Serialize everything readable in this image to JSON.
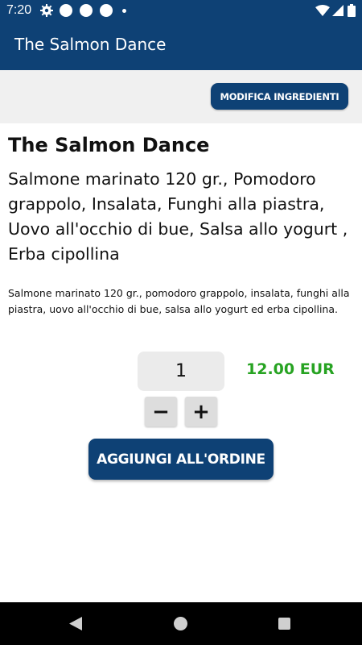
{
  "status_bar": {
    "time": "7:20",
    "icons": [
      "gear-icon",
      "notification-dot-icon",
      "notification-dot-icon",
      "notification-dot-icon",
      "small-dot-icon",
      "wifi-icon",
      "signal-icon",
      "battery-icon"
    ]
  },
  "app_bar": {
    "title": "The Salmon Dance"
  },
  "toolbar": {
    "edit_ingredients_label": "MODIFICA INGREDIENTI"
  },
  "dish": {
    "name": "The Salmon Dance",
    "ingredients": "Salmone marinato 120 gr., Pomodoro grappolo, Insalata, Funghi alla piastra, Uovo all'occhio di bue, Salsa allo yogurt , Erba cipollina",
    "description": "Salmone marinato 120 gr., pomodoro grappolo, insalata, funghi alla piastra, uovo all'occhio di bue, salsa allo yogurt ed erba cipollina."
  },
  "order": {
    "quantity": "1",
    "price": "12.00 EUR",
    "minus_label": "−",
    "plus_label": "+",
    "add_label": "AGGIUNGI ALL'ORDINE"
  },
  "colors": {
    "primary": "#0e4175",
    "price": "#27a322",
    "strip": "#f0f0f0"
  }
}
